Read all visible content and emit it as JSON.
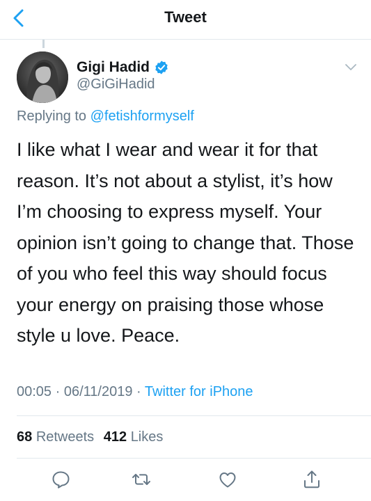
{
  "nav": {
    "title": "Tweet",
    "back_icon": "chevron-left-icon"
  },
  "tweet": {
    "author_name": "Gigi Hadid",
    "author_handle": "@GiGiHadid",
    "verified": true,
    "replying_prefix": "Replying to",
    "replying_to": "@fetishformyself",
    "text": "I like what I wear and wear it for that reason. It’s not about a stylist, it’s how I’m choosing to express myself. Your opinion isn’t going to change that. Those of you who feel this way should focus your energy on praising those whose style u love. Peace.",
    "time": "00:05",
    "date": "06/11/2019",
    "separator": "·",
    "source": "Twitter for iPhone"
  },
  "stats": {
    "retweets_count": "68",
    "retweets_label": "Retweets",
    "likes_count": "412",
    "likes_label": "Likes"
  },
  "actions": [
    "reply-icon",
    "retweet-icon",
    "like-icon",
    "share-icon"
  ],
  "colors": {
    "accent": "#1da1f2",
    "text": "#14171a",
    "secondary": "#657786",
    "divider": "#e1e8ed"
  }
}
